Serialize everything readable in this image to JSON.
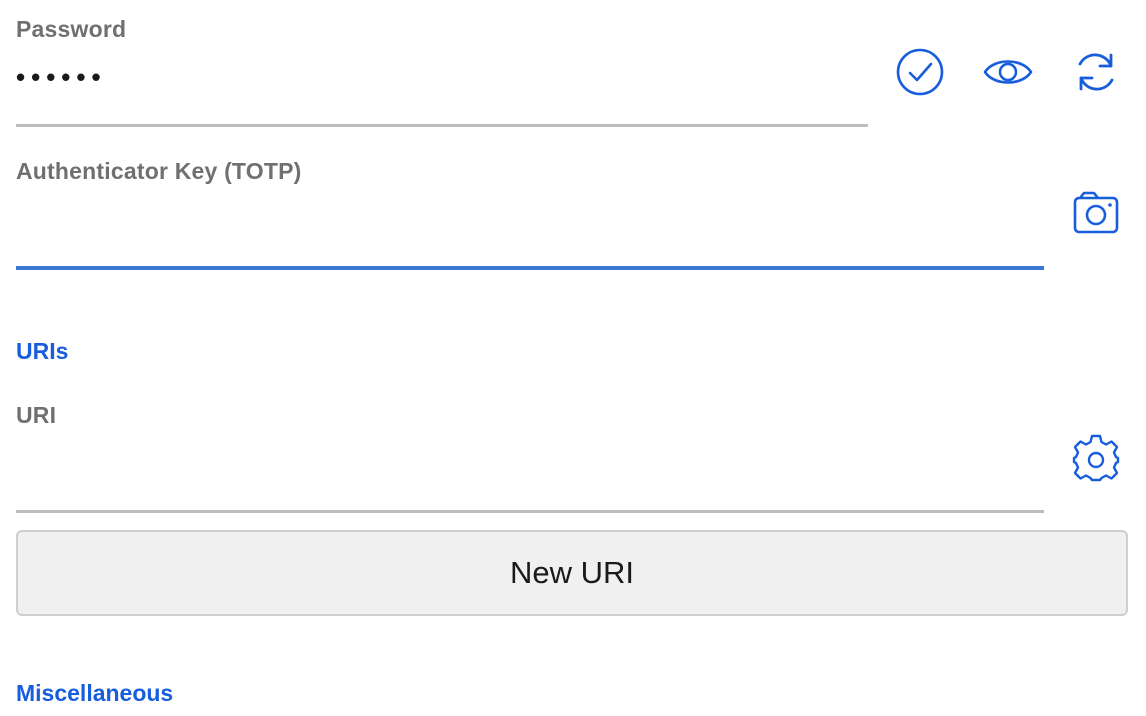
{
  "password": {
    "label": "Password",
    "value": "••••••",
    "icons": [
      "check-circle-icon",
      "eye-icon",
      "refresh-icon"
    ]
  },
  "totp": {
    "label": "Authenticator Key (TOTP)",
    "value": "",
    "icon": "camera-icon"
  },
  "uris": {
    "section_title": "URIs",
    "uri_label": "URI",
    "uri_value": "",
    "icon": "gear-icon",
    "new_uri_label": "New URI"
  },
  "misc": {
    "section_title": "Miscellaneous"
  },
  "colors": {
    "accent": "#175ddc",
    "focused_underline": "#3a78d4",
    "label": "#707070"
  }
}
